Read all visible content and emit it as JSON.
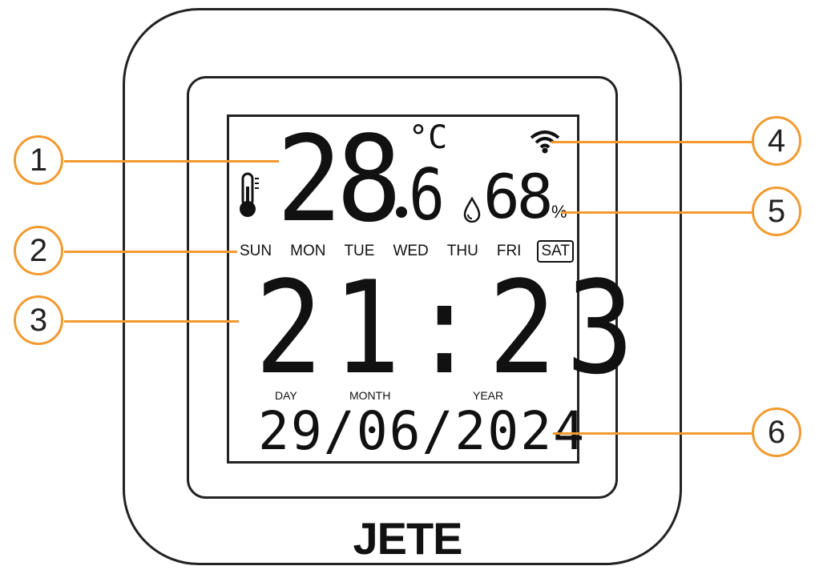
{
  "display": {
    "temperature_int": "28",
    "temperature_dec": "6",
    "temperature_unit": "°C",
    "humidity": "68",
    "humidity_unit": "%",
    "weekdays": [
      "SUN",
      "MON",
      "TUE",
      "WED",
      "THU",
      "FRI",
      "SAT"
    ],
    "active_weekday": "SAT",
    "time": "21:23",
    "date_labels": {
      "day": "DAY",
      "month": "MONTH",
      "year": "YEAR"
    },
    "date": "29/06/2024"
  },
  "brand": "JETE",
  "callouts": [
    "1",
    "2",
    "3",
    "4",
    "5",
    "6"
  ],
  "colors": {
    "callout": "#f29a2e",
    "outline": "#222222"
  }
}
